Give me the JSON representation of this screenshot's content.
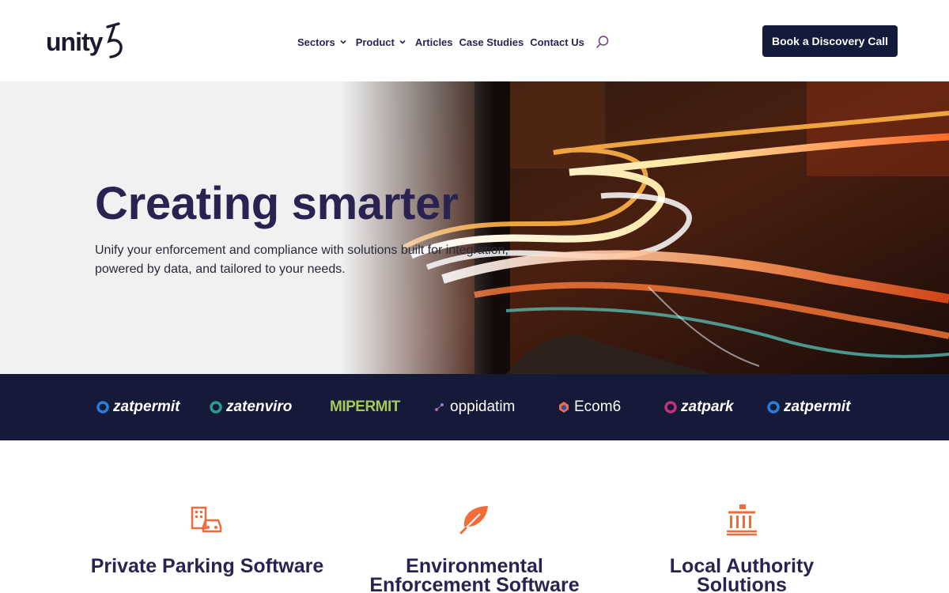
{
  "header": {
    "logo_text": "unity5",
    "nav": [
      {
        "label": "Sectors",
        "has_dropdown": true
      },
      {
        "label": "Product",
        "has_dropdown": true
      },
      {
        "label": "Articles",
        "has_dropdown": false
      },
      {
        "label": "Case Studies",
        "has_dropdown": false
      },
      {
        "label": "Contact Us",
        "has_dropdown": false
      }
    ],
    "search_icon": "search-icon",
    "cta_label": "Book a Discovery Call"
  },
  "hero": {
    "title": "Creating smarter",
    "subtitle": "Unify your enforcement and compliance with solutions built for integration, powered by data, and tailored to your needs."
  },
  "brands": [
    {
      "name": "zatpermit",
      "color": "#2f7ad9"
    },
    {
      "name": "zatenviro",
      "color": "#2a9d8f"
    },
    {
      "name": "MIPERMIT",
      "color": "#a7c957"
    },
    {
      "name": "oppidatim",
      "color": "#b565a7"
    },
    {
      "name": "Ecom6",
      "color": "#e76f51"
    },
    {
      "name": "zatpark",
      "color": "#c2307f"
    },
    {
      "name": "zatpermit",
      "color": "#2f7ad9"
    }
  ],
  "sectors": [
    {
      "title": "Private Parking Software",
      "icon": "parking-building-icon"
    },
    {
      "title": "Environmental Enforcement Software",
      "icon": "leaf-icon"
    },
    {
      "title": "Local Authority Solutions",
      "icon": "government-building-icon"
    }
  ],
  "colors": {
    "primary_dark": "#141a3a",
    "heading": "#2a2250",
    "accent_orange": "#f26b3a"
  }
}
